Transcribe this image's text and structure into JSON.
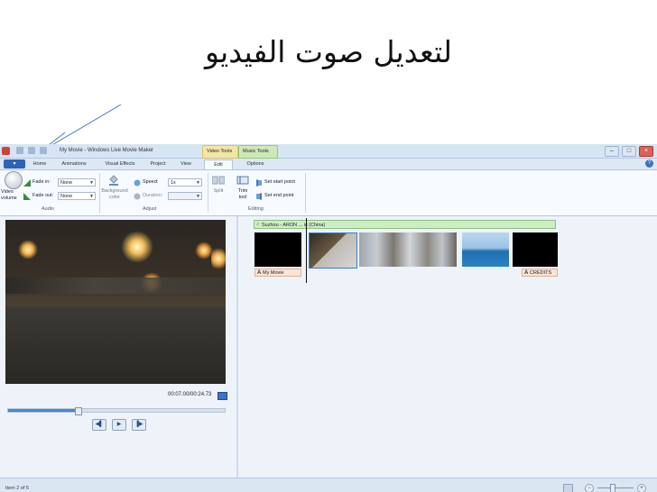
{
  "slide": {
    "title": "لتعديل صوت الفيديو"
  },
  "window": {
    "title": "My Movie - Windows Live Movie Maker",
    "context_video": "Video Tools",
    "context_music": "Music Tools",
    "file_label": "▾"
  },
  "tabs": [
    "Home",
    "Animations",
    "Visual Effects",
    "Project",
    "View",
    "Edit",
    "Options"
  ],
  "ribbon": {
    "video_volume": "Video volume",
    "fade_in_label": "Fade in:",
    "fade_in_value": "None",
    "fade_out_label": "Fade out:",
    "fade_out_value": "None",
    "background_color": "Background color",
    "speed_label": "Speed:",
    "speed_value": "1x",
    "duration_label": "Duration:",
    "split": "Split",
    "trim_tool": "Trim tool",
    "set_start_point": "Set start point",
    "set_end_point": "Set end point",
    "groups": {
      "audio": "Audio",
      "adjust": "Adjust",
      "editing": "Editing"
    }
  },
  "preview": {
    "time": "00:07.00/00:24.73",
    "progress": 0.31
  },
  "storyboard": {
    "music_track": "Suzhou - ARON ... ic (China)",
    "title_caption": "My Movie",
    "credits_caption": "CREDITS"
  },
  "status": {
    "item": "Item 2 of 5"
  },
  "colors": {
    "accent": "#2c64b8",
    "music": "#cdeec3",
    "caption": "#fbe4d3",
    "pointer": "#4a78c8"
  },
  "icons": [
    "app-icon",
    "volume-icon",
    "fade-in-icon",
    "fade-out-icon",
    "speed-icon",
    "split-icon",
    "trim-icon",
    "start-point-icon",
    "end-point-icon",
    "music-note-icon",
    "fullscreen-icon",
    "help-icon"
  ]
}
